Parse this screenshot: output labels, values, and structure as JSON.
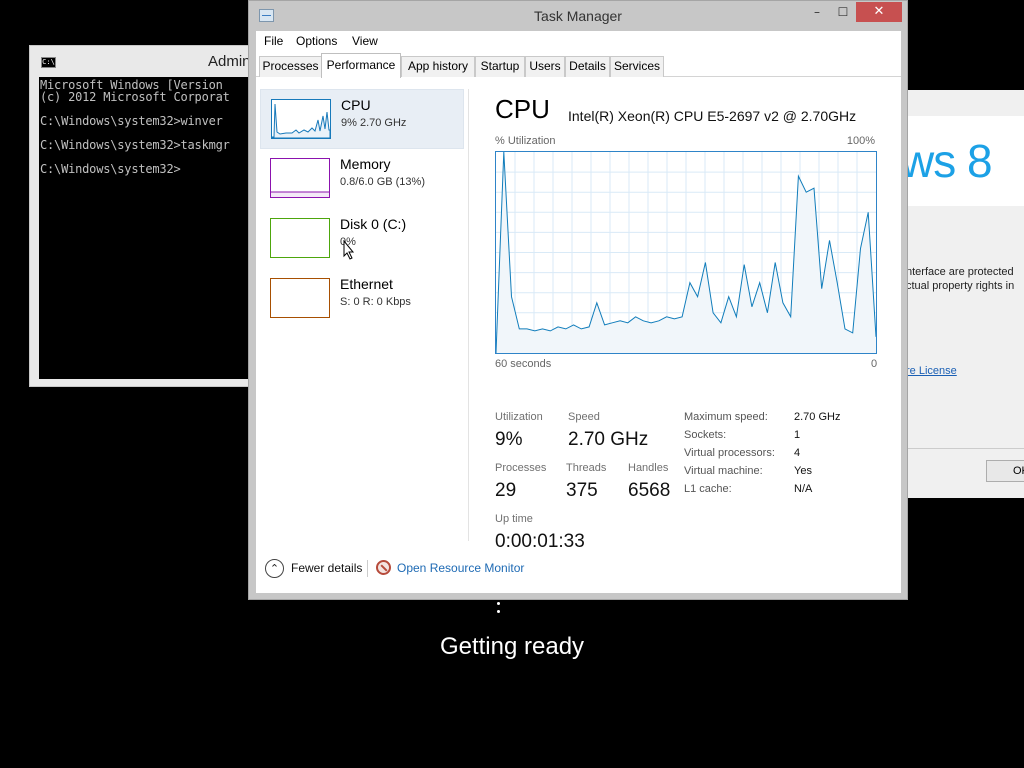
{
  "background": {
    "cmd": {
      "title": "Admin",
      "icon": "cmd-icon",
      "icon_text": "C:\\",
      "lines": [
        "Microsoft Windows [Version",
        "(c) 2012 Microsoft Corporat",
        "",
        "C:\\Windows\\system32>winver",
        "",
        "C:\\Windows\\system32>taskmgr",
        "",
        "C:\\Windows\\system32>"
      ]
    },
    "winver": {
      "logo_text": "ws 8",
      "text_line1": "nterface are protected",
      "text_line2": "ctual property rights in",
      "link": "re License",
      "ok_button": "OK"
    },
    "status": "Getting ready"
  },
  "task_manager": {
    "title": "Task Manager",
    "controls": {
      "minimize": "–",
      "maximize": "☐",
      "close": "✕"
    },
    "menu": [
      "File",
      "Options",
      "View"
    ],
    "tabs": [
      "Processes",
      "Performance",
      "App history",
      "Startup",
      "Users",
      "Details",
      "Services"
    ],
    "active_tab": "Performance",
    "resources": [
      {
        "name": "CPU",
        "sub": "9% 2.70 GHz",
        "color": "#1779ba"
      },
      {
        "name": "Memory",
        "sub": "0.8/6.0 GB (13%)",
        "color": "#8b12ae"
      },
      {
        "name": "Disk 0 (C:)",
        "sub": "0%",
        "color": "#4da60c"
      },
      {
        "name": "Ethernet",
        "sub": "S: 0 R: 0 Kbps",
        "color": "#a74f01"
      }
    ],
    "cpu": {
      "heading": "CPU",
      "model": "Intel(R) Xeon(R) CPU E5-2697 v2 @ 2.70GHz",
      "util_label": "% Utilization",
      "max_label": "100%",
      "time_left": "60 seconds",
      "time_right": "0",
      "stats": {
        "utilization_label": "Utilization",
        "utilization": "9%",
        "speed_label": "Speed",
        "speed": "2.70 GHz",
        "processes_label": "Processes",
        "processes": "29",
        "threads_label": "Threads",
        "threads": "375",
        "handles_label": "Handles",
        "handles": "6568",
        "uptime_label": "Up time",
        "uptime": "0:00:01:33"
      },
      "specs": [
        {
          "label": "Maximum speed:",
          "value": "2.70 GHz"
        },
        {
          "label": "Sockets:",
          "value": "1"
        },
        {
          "label": "Virtual processors:",
          "value": "4"
        },
        {
          "label": "Virtual machine:",
          "value": "Yes"
        },
        {
          "label": "L1 cache:",
          "value": "N/A"
        }
      ]
    },
    "footer": {
      "fewer_details": "Fewer details",
      "open_resource_monitor": "Open Resource Monitor"
    }
  },
  "chart_data": {
    "type": "area",
    "title": "CPU",
    "ylabel": "% Utilization",
    "xlim": [
      60,
      0
    ],
    "ylim": [
      0,
      100
    ],
    "grid": true,
    "color": "#117dbb",
    "fill": "#f1f6fa",
    "series": [
      {
        "values": [
          0,
          100,
          28,
          12,
          12,
          11,
          12,
          11,
          13,
          12,
          14,
          12,
          13,
          25,
          14,
          15,
          16,
          15,
          18,
          16,
          15,
          16,
          18,
          17,
          18,
          35,
          28,
          45,
          20,
          15,
          28,
          18,
          44,
          23,
          35,
          20,
          45,
          25,
          18,
          88,
          80,
          82,
          32,
          56,
          35,
          12,
          10,
          52,
          70,
          8
        ]
      }
    ]
  }
}
